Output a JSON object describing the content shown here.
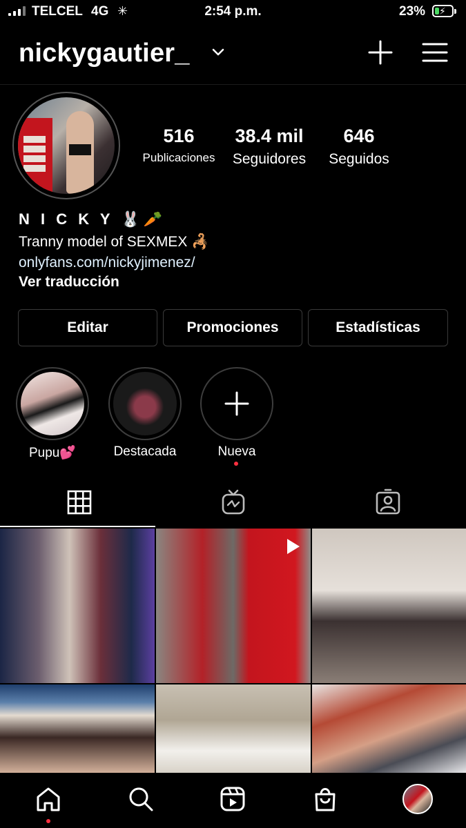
{
  "status_bar": {
    "carrier": "TELCEL",
    "network": "4G",
    "time": "2:54 p.m.",
    "battery": "23%"
  },
  "header": {
    "username": "nickygautier_"
  },
  "profile": {
    "stats": [
      {
        "value": "516",
        "label": "Publicaciones"
      },
      {
        "value": "38.4 mil",
        "label": "Seguidores"
      },
      {
        "value": "646",
        "label": "Seguidos"
      }
    ],
    "bio": {
      "name": "N I C K Y 🐰🥕",
      "line1": "Tranny model of SEXMEX 🦂",
      "link": "onlyfans.com/nickyjimenez/",
      "translate": "Ver traducción"
    },
    "buttons": {
      "edit": "Editar",
      "promotions": "Promociones",
      "insights": "Estadísticas"
    }
  },
  "highlights": [
    {
      "label": "Pupu💕"
    },
    {
      "label": "Destacada"
    },
    {
      "label": "Nueva"
    }
  ],
  "colors": {
    "background": "#000000",
    "notification_dot": "#ff3040",
    "battery_fill": "#4cd964",
    "link": "#e0f1ff"
  }
}
